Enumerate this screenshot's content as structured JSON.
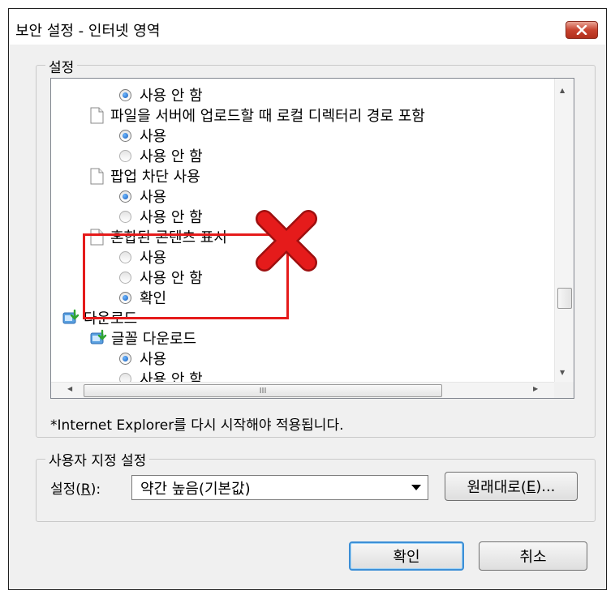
{
  "window": {
    "title": "보안 설정 - 인터넷 영역",
    "close_icon": "close-icon"
  },
  "settings_group": {
    "label": "설정"
  },
  "tree": [
    {
      "kind": "radio",
      "checked": true,
      "label": "사용 안 함"
    },
    {
      "kind": "setting",
      "label": "파일을 서버에 업로드할 때 로컬 디렉터리 경로 포함"
    },
    {
      "kind": "radio",
      "checked": true,
      "label": "사용"
    },
    {
      "kind": "radio",
      "checked": false,
      "label": "사용 안 함"
    },
    {
      "kind": "setting",
      "label": "팝업 차단 사용"
    },
    {
      "kind": "radio",
      "checked": true,
      "label": "사용"
    },
    {
      "kind": "radio",
      "checked": false,
      "label": "사용 안 함"
    },
    {
      "kind": "setting",
      "label": "혼합된 콘텐츠 표시"
    },
    {
      "kind": "radio",
      "checked": false,
      "label": "사용"
    },
    {
      "kind": "radio",
      "checked": false,
      "label": "사용 안 함"
    },
    {
      "kind": "radio",
      "checked": true,
      "label": "확인"
    },
    {
      "kind": "category",
      "label": "다운로드"
    },
    {
      "kind": "subcategory",
      "label": "글꼴 다운로드"
    },
    {
      "kind": "radio",
      "checked": true,
      "label": "사용"
    },
    {
      "kind": "radio",
      "checked": false,
      "label": "사용 안 함"
    }
  ],
  "scroll": {
    "hthumb_grip": "III",
    "up": "▲",
    "down": "▼",
    "left": "◀",
    "right": "▶"
  },
  "note": "*Internet Explorer를 다시 시작해야 적용됩니다.",
  "custom_group": {
    "label": "사용자 지정 설정",
    "reset_to_label_prefix": "설정(",
    "reset_to_label_key": "R",
    "reset_to_label_suffix": "):",
    "combo_value": "약간 높음(기본값)",
    "reset_button_prefix": "원래대로(",
    "reset_button_key": "E",
    "reset_button_suffix": ")..."
  },
  "buttons": {
    "ok": "확인",
    "cancel": "취소"
  },
  "colors": {
    "annotation_red": "#e51b1b",
    "default_button_border": "#3c8fd6"
  }
}
